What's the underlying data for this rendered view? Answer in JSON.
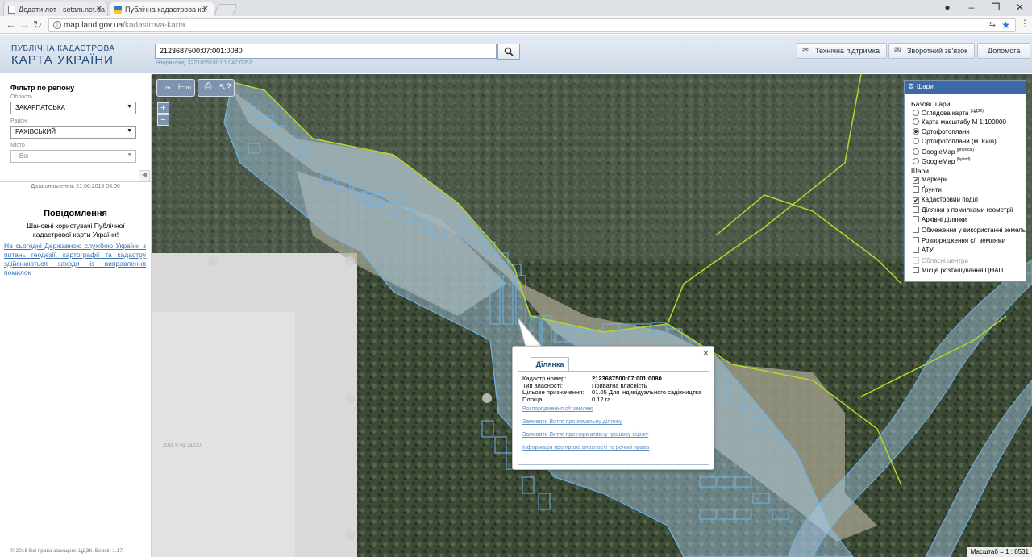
{
  "browser": {
    "tabs": [
      {
        "title": "Додати лот - setam.net.ua"
      },
      {
        "title": "Публічна кадастрова ка"
      }
    ],
    "url_host": "map.land.gov.ua",
    "url_path": "/kadastrova-karta"
  },
  "header": {
    "logo_line1": "ПУБЛІЧНА КАДАСТРОВА",
    "logo_line2": "КАРТА УКРАЇНИ",
    "search_value": "2123687500:07:001:0080",
    "search_hint": "Наприклад: 3221655100:01:047:0052",
    "buttons": {
      "support": "Технічна підтримка",
      "feedback": "Зворотний зв'язок",
      "help": "Допомога"
    }
  },
  "sidebar": {
    "filter_title": "Фільтр по регіону",
    "oblast_label": "Область",
    "oblast_value": "ЗАКАРПАТСЬКА",
    "raion_label": "Район",
    "raion_value": "РАХІВСЬКИЙ",
    "city_label": "Місто",
    "city_value": "- Всі -",
    "updated": "Дата оновлення: 21.06.2018 03:00",
    "news_title": "Повідомлення",
    "news_greeting": "Шановні користувачі Публічної кадастрової карти України!",
    "news_link": "На сьогодні Державною службою України з питань геодезії, картографії та кадастру здійснюються заходи із виправлення помилок",
    "copyright": "© 2016 Всі права захищені. ЦДЗК. Версія 1.17."
  },
  "map": {
    "scale_text": "Масштаб = 1 : 8531",
    "overlay_label": "2018 © vd. SLOO",
    "colors": {
      "parcel_fill": "#a9cbe8",
      "parcel_stroke": "#6fb3e8",
      "boundary": "#b5d62a"
    }
  },
  "layers": {
    "title": "Шари",
    "base_title": "Базові шари",
    "base": [
      {
        "label": "Оглядова карта",
        "sup": "(ЦДЗК)",
        "checked": false
      },
      {
        "label": "Карта масштабу М 1:100000",
        "sup": "",
        "checked": false
      },
      {
        "label": "Ортофотоплани",
        "sup": "",
        "checked": true
      },
      {
        "label": "Ортофотоплани (м. Київ)",
        "sup": "",
        "checked": false
      },
      {
        "label": "GoogleMap",
        "sup": "(physical)",
        "checked": false
      },
      {
        "label": "GoogleMap",
        "sup": "(hybrid)",
        "checked": false
      }
    ],
    "overlay_title": "Шари",
    "overlays": [
      {
        "label": "Маркери",
        "checked": true,
        "disabled": false
      },
      {
        "label": "Ґрунти",
        "checked": false,
        "disabled": false
      },
      {
        "label": "Кадастровий поділ",
        "checked": true,
        "disabled": false
      },
      {
        "label": "Ділянки з помилками геометрії",
        "checked": false,
        "disabled": false
      },
      {
        "label": "Архівні ділянки",
        "checked": false,
        "disabled": false
      },
      {
        "label": "Обмеження у використанні земель",
        "checked": false,
        "disabled": false
      },
      {
        "label": "Розпорядження с/г землями",
        "checked": false,
        "disabled": false
      },
      {
        "label": "АТУ",
        "checked": false,
        "disabled": false
      },
      {
        "label": "Обласні центри",
        "checked": false,
        "disabled": true
      },
      {
        "label": "Місце розташування ЦНАП",
        "checked": false,
        "disabled": false
      }
    ]
  },
  "popup": {
    "tab": "Ділянка",
    "fields": [
      {
        "key": "Кадастр.номер:",
        "value": "2123687500:07:001:0080",
        "bold": true
      },
      {
        "key": "Тип власності:",
        "value": "Приватна власність",
        "bold": false
      },
      {
        "key": "Цільове призначення:",
        "value": "01.05 Для індивідуального садівництва",
        "bold": false
      },
      {
        "key": "Площа:",
        "value": "0.12 га",
        "bold": false
      }
    ],
    "links": [
      "Розпорядження с/г землею",
      "Замовити Витяг про земельну ділянку",
      "Замовити Витяг про нормативну грошову оцінку",
      "Інформація про право власності та речові права"
    ]
  }
}
